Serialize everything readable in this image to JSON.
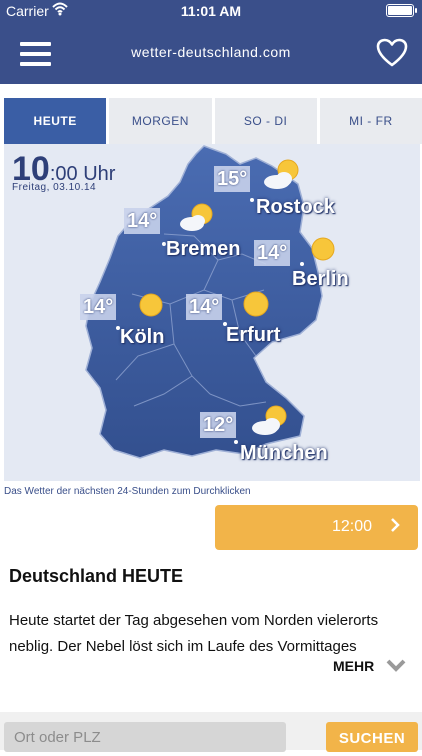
{
  "status_bar": {
    "carrier": "Carrier",
    "time": "11:01 AM"
  },
  "nav": {
    "logo_text": "wetter-deutschland.com",
    "menu_icon": "hamburger-menu-icon",
    "favorite_icon": "heart-icon"
  },
  "tabs": [
    {
      "label": "HEUTE",
      "active": true
    },
    {
      "label": "MORGEN",
      "active": false
    },
    {
      "label": "SO - DI",
      "active": false
    },
    {
      "label": "MI - FR",
      "active": false
    }
  ],
  "map": {
    "time_hour": "10",
    "time_rest": ":00 Uhr",
    "date": "Freitag, 03.10.14",
    "cities": [
      {
        "name": "Rostock",
        "temp": "15°",
        "icon": "sun-cloud-icon"
      },
      {
        "name": "Bremen",
        "temp": "14°",
        "icon": "sun-cloud-icon"
      },
      {
        "name": "Berlin",
        "temp": "14°",
        "icon": "sun-icon"
      },
      {
        "name": "Köln",
        "temp": "14°",
        "icon": "sun-icon"
      },
      {
        "name": "Erfurt",
        "temp": "14°",
        "icon": "sun-icon"
      },
      {
        "name": "München",
        "temp": "12°",
        "icon": "sun-cloud-icon"
      }
    ]
  },
  "caption": "Das Wetter der nächsten 24-Stunden zum Durchklicken",
  "time_button": {
    "label": "12:00",
    "arrow_icon": "chevron-right-icon"
  },
  "article": {
    "title": "Deutschland HEUTE",
    "text": "Heute startet der Tag abgesehen vom Norden vielerorts neblig. Der Nebel löst sich im Laufe des Vormittages",
    "more_label": "MEHR"
  },
  "search": {
    "placeholder": "Ort oder PLZ",
    "button_label": "SUCHEN"
  },
  "colors": {
    "brand": "#3a4f8a",
    "accent": "#f2b449",
    "map_land": "#3b5aa0"
  }
}
